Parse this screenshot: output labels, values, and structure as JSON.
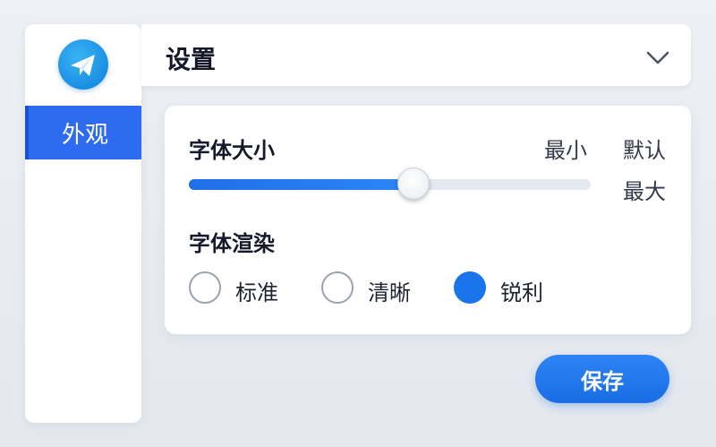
{
  "sidebar": {
    "logo_icon": "paper-plane-icon",
    "items": [
      {
        "label": "外观",
        "active": true
      }
    ]
  },
  "header": {
    "title": "设置",
    "dropdown_icon": "chevron-down-icon"
  },
  "font_size": {
    "label": "字体大小",
    "min_label": "最小",
    "default_label": "默认",
    "max_label": "最大",
    "value_fraction": 0.56
  },
  "font_rendering": {
    "label": "字体渲染",
    "options": [
      {
        "label": "标准",
        "selected": false
      },
      {
        "label": "清晰",
        "selected": false
      },
      {
        "label": "锐利",
        "selected": true
      }
    ]
  },
  "save_label": "保存",
  "colors": {
    "accent": "#1a74ea",
    "nav_active": "#2d6bf0"
  }
}
